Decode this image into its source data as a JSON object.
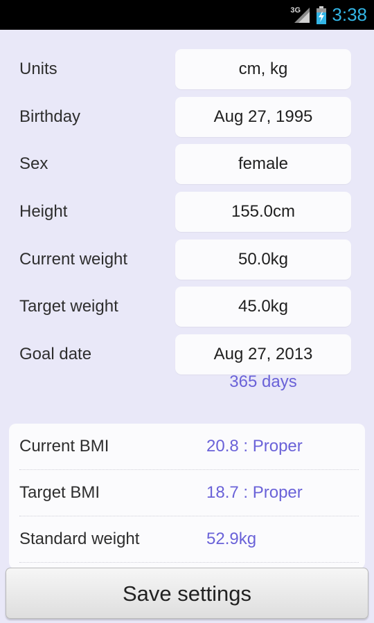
{
  "status_bar": {
    "network": "3G",
    "time": "3:38",
    "accent": "#33b5e5"
  },
  "form": {
    "rows": [
      {
        "label": "Units",
        "value": "cm, kg"
      },
      {
        "label": "Birthday",
        "value": "Aug 27, 1995"
      },
      {
        "label": "Sex",
        "value": "female"
      },
      {
        "label": "Height",
        "value": "155.0cm"
      },
      {
        "label": "Current weight",
        "value": "50.0kg"
      },
      {
        "label": "Target weight",
        "value": "45.0kg"
      },
      {
        "label": "Goal date",
        "value": "Aug 27, 2013"
      }
    ],
    "days_until_goal": "365 days"
  },
  "stats": {
    "items": [
      {
        "label": "Current BMI",
        "value": "20.8 : Proper"
      },
      {
        "label": "Target BMI",
        "value": "18.7 : Proper"
      },
      {
        "label": "Standard weight",
        "value": "52.9kg"
      }
    ]
  },
  "save_button": {
    "label": "Save settings"
  },
  "colors": {
    "background": "#e9e8f8",
    "accent_value": "#6a62d8",
    "field_bg": "#fbfbfd"
  }
}
